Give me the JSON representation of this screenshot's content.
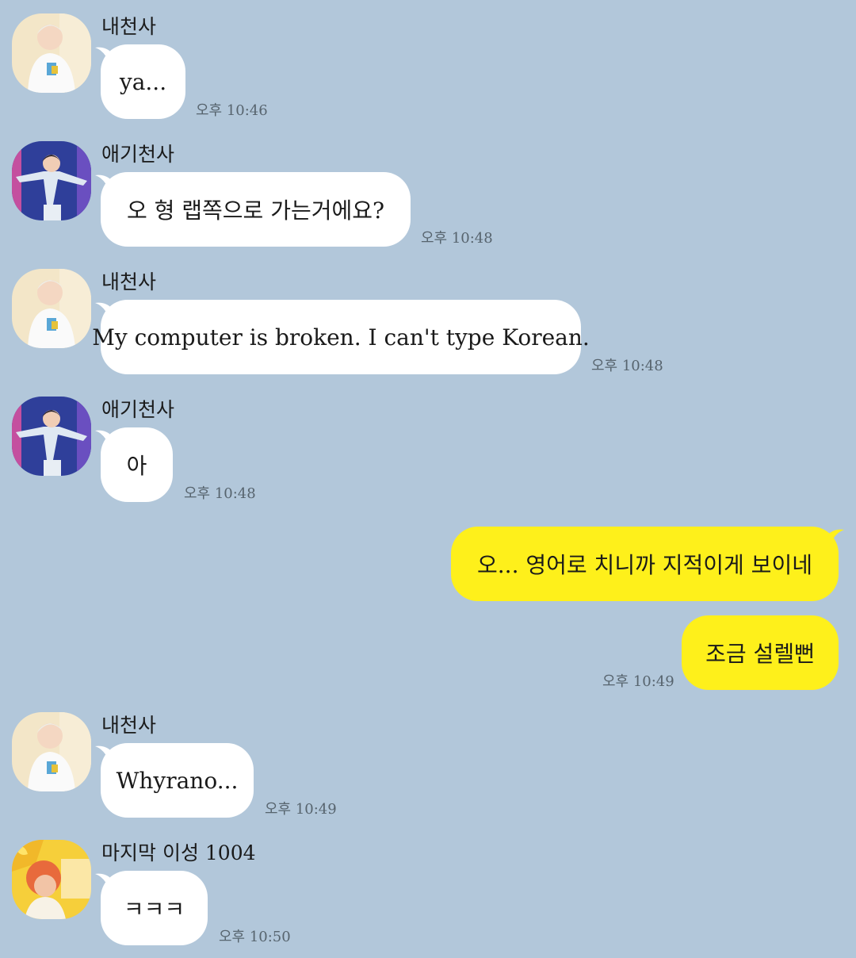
{
  "chat": {
    "messages": [
      {
        "sender": "내천사",
        "text": "ya...",
        "time": "오후 10:46"
      },
      {
        "sender": "애기천사",
        "text": "오 형 랩쪽으로 가는거에요?",
        "time": "오후 10:48"
      },
      {
        "sender": "내천사",
        "text": "My computer is broken. I can't type Korean.",
        "time": "오후 10:48"
      },
      {
        "sender": "애기천사",
        "text": "아",
        "time": "오후 10:48"
      },
      {
        "sender": "me",
        "text": "오... 영어로 치니까 지적이게 보이네",
        "time": ""
      },
      {
        "sender": "me",
        "text": "조금 설렐뻔",
        "time": "오후 10:49"
      },
      {
        "sender": "내천사",
        "text": "Whyrano...",
        "time": "오후 10:49"
      },
      {
        "sender": "마지막 이성 1004",
        "text": "ㅋㅋㅋ",
        "time": "오후 10:50"
      }
    ]
  },
  "colors": {
    "background": "#b2c7da",
    "incoming_bubble": "#ffffff",
    "outgoing_bubble": "#fef01b",
    "timestamp": "#57646e"
  },
  "icons": {
    "avatar_1": "profile-photo-white-hair",
    "avatar_2": "profile-photo-stage-blue",
    "avatar_3": "profile-photo-orange-hair-butter"
  }
}
